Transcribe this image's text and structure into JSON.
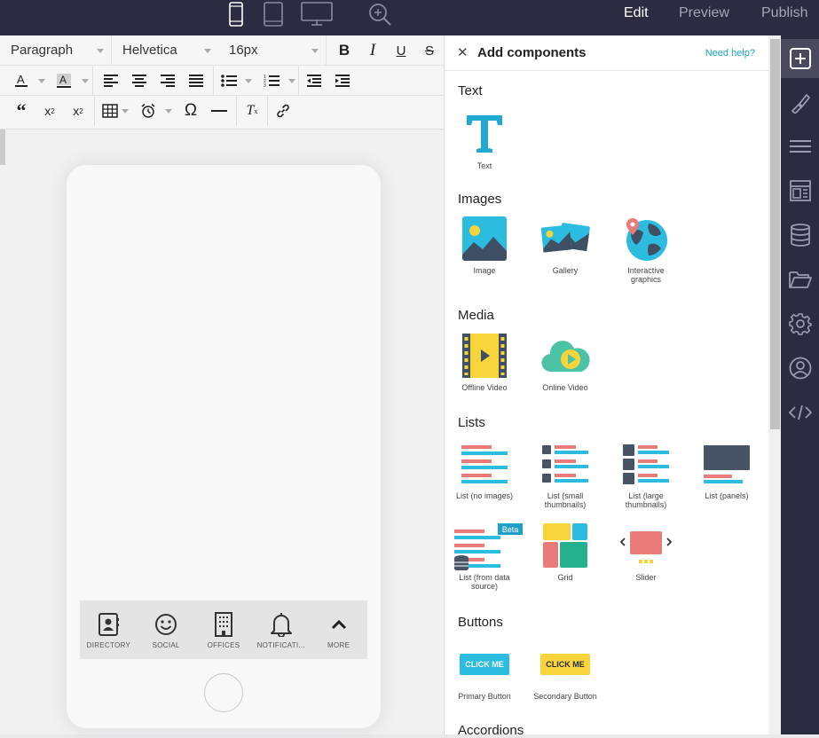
{
  "topbar": {
    "devices": [
      "phone-icon",
      "tablet-icon",
      "desktop-icon"
    ],
    "zoom_icon": "zoom-in-icon",
    "edit_label": "Edit",
    "preview_label": "Preview",
    "publish_label": "Publish"
  },
  "editor": {
    "block_format": "Paragraph",
    "font_family": "Helvetica",
    "font_size": "16px"
  },
  "app_tabs": [
    {
      "label": "DIRECTORY",
      "icon": "directory-icon"
    },
    {
      "label": "SOCIAL",
      "icon": "smiley-icon"
    },
    {
      "label": "OFFICES",
      "icon": "building-icon"
    },
    {
      "label": "NOTIFICATI...",
      "icon": "bell-icon"
    },
    {
      "label": "MORE",
      "icon": "chevron-up-icon"
    }
  ],
  "panel": {
    "title": "Add components",
    "help": "Need help?",
    "sections": {
      "text": "Text",
      "images": "Images",
      "media": "Media",
      "lists": "Lists",
      "buttons": "Buttons",
      "accordions": "Accordions"
    },
    "components": {
      "text": "Text",
      "image": "Image",
      "gallery": "Gallery",
      "interactive_1": "Interactive",
      "interactive_2": "graphics",
      "offline_video": "Offline Video",
      "online_video": "Online Video",
      "list_no_images": "List (no images)",
      "list_small_1": "List (small",
      "list_small_2": "thumbnails)",
      "list_large_1": "List (large",
      "list_large_2": "thumbnails)",
      "list_panels": "List (panels)",
      "list_data_1": "List (from data",
      "list_data_2": "source)",
      "beta": "Beta",
      "grid": "Grid",
      "slider": "Slider",
      "primary_button": "Primary Button",
      "secondary_button": "Secondary Button",
      "click_me": "CLICK ME"
    }
  },
  "right_sidebar": [
    "add-icon",
    "brush-icon",
    "menu-icon",
    "layout-icon",
    "database-icon",
    "folder-icon",
    "settings-icon",
    "account-icon",
    "code-icon"
  ],
  "colors": {
    "topbar": "#2b2b42",
    "accent": "#20b2cf",
    "list_pink": "#e97b7b",
    "list_dark": "#485466",
    "button_yellow": "#f7d43a"
  }
}
